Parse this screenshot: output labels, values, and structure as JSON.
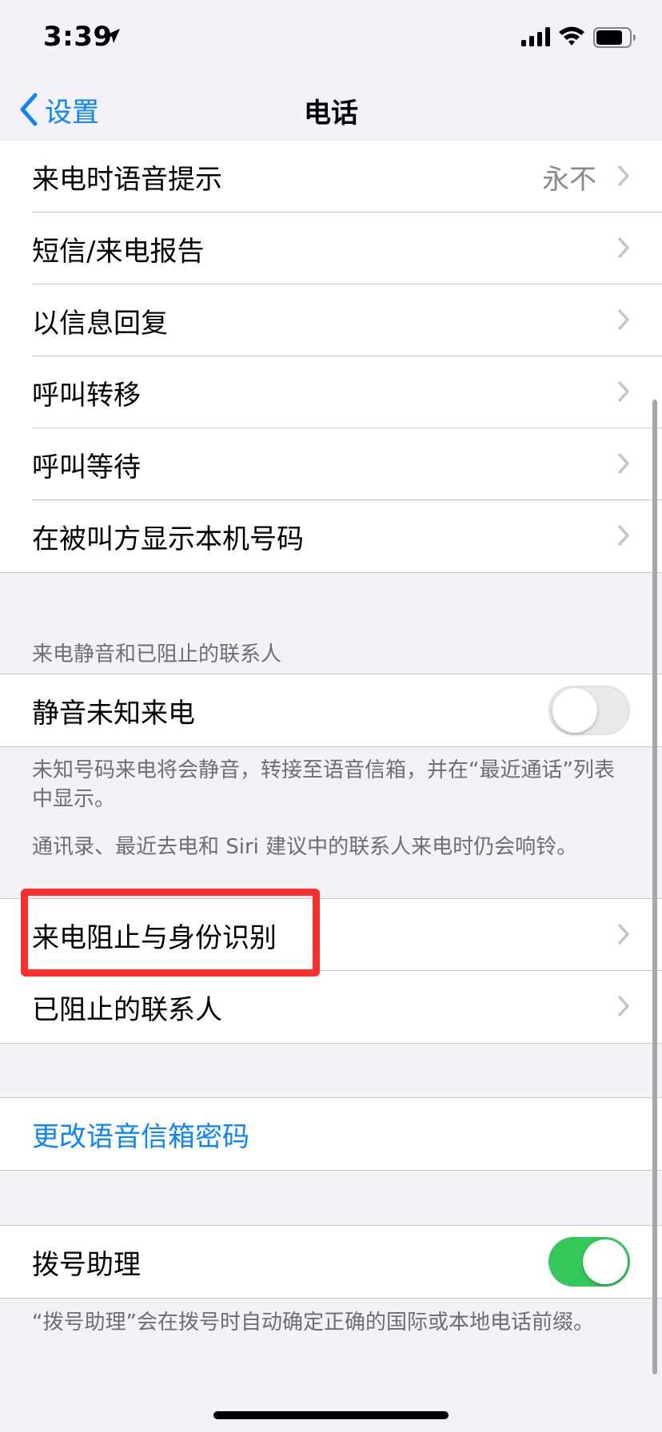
{
  "status_bar": {
    "time": "3:39",
    "icons": [
      "location-arrow-icon",
      "signal-icon",
      "wifi-icon",
      "battery-icon"
    ]
  },
  "nav": {
    "back_label": "设置",
    "title": "电话"
  },
  "group1": [
    {
      "label": "来电时语音提示",
      "detail": "永不"
    },
    {
      "label": "短信/来电报告"
    },
    {
      "label": "以信息回复"
    },
    {
      "label": "呼叫转移"
    },
    {
      "label": "呼叫等待"
    },
    {
      "label": "在被叫方显示本机号码"
    }
  ],
  "silence_section": {
    "header": "来电静音和已阻止的联系人",
    "silence_unknown": {
      "label": "静音未知来电",
      "enabled": false
    },
    "footer1": "未知号码来电将会静音，转接至语音信箱，并在“最近通话”列表中显示。",
    "footer2": "通讯录、最近去电和 Siri 建议中的联系人来电时仍会响铃。"
  },
  "group_blocking": [
    {
      "label": "来电阻止与身份识别",
      "highlighted": true
    },
    {
      "label": "已阻止的联系人"
    }
  ],
  "voicemail": {
    "label": "更改语音信箱密码"
  },
  "dial_assist": {
    "label": "拨号助理",
    "enabled": true,
    "footer": "“拨号助理”会在拨号时自动确定正确的国际或本地电话前缀。"
  },
  "colors": {
    "accent": "#0a84ff",
    "toggle_on": "#34c759",
    "highlight": "#ff2e2e",
    "background": "#f2f2f7"
  }
}
